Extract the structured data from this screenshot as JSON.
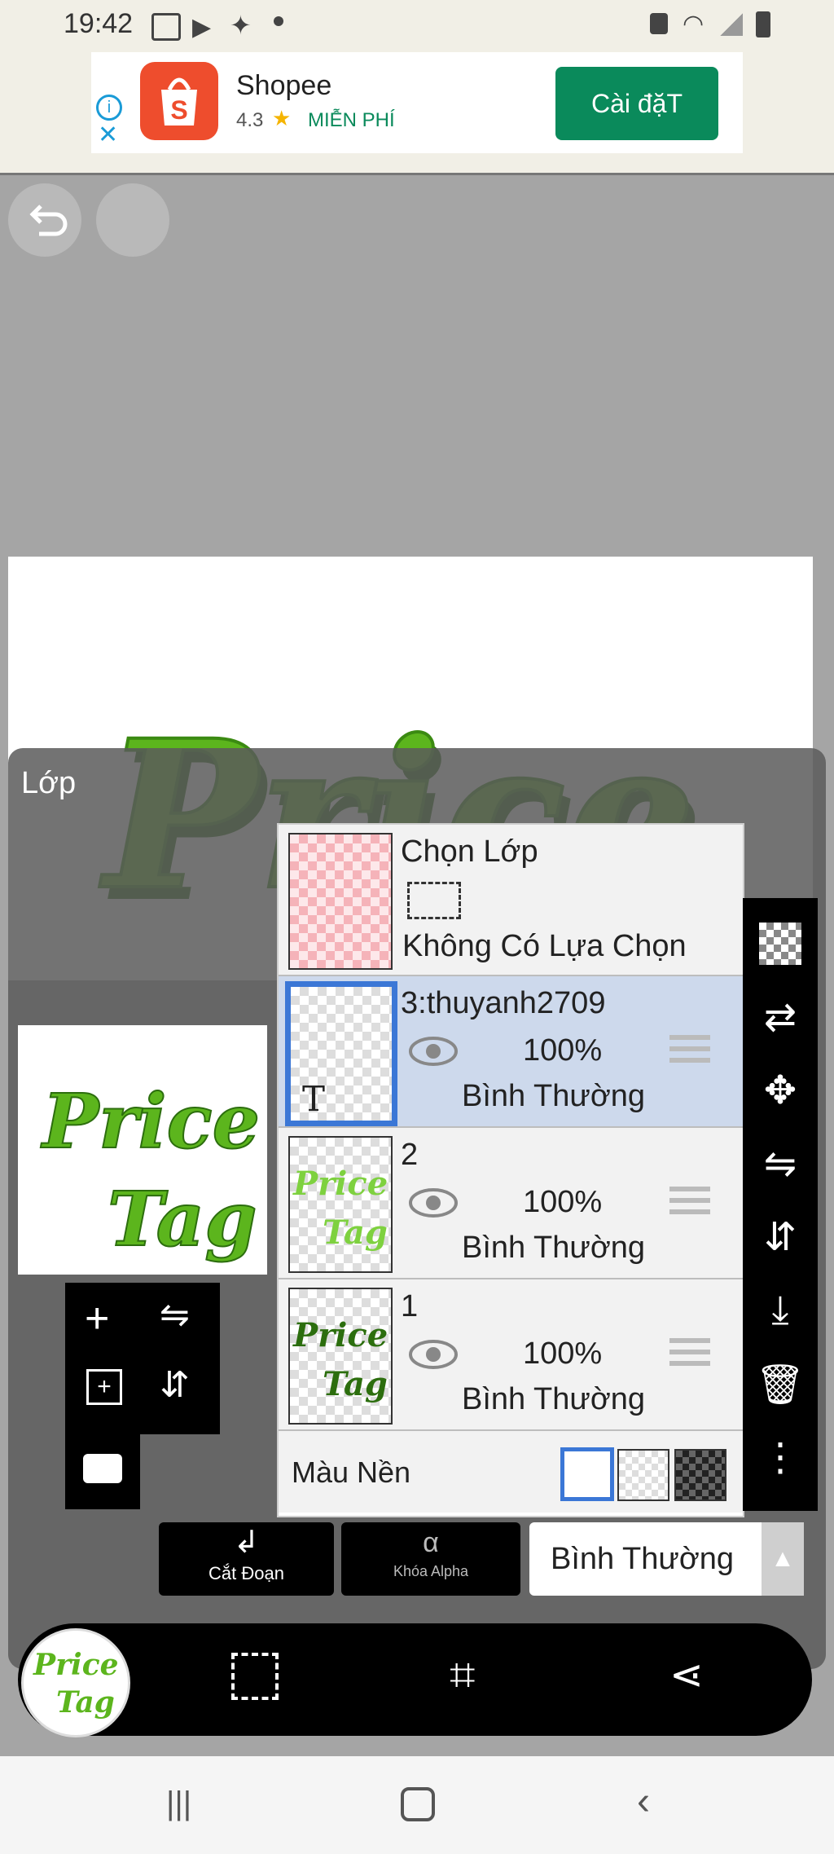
{
  "status_bar": {
    "time": "19:42"
  },
  "ad": {
    "app_name": "Shopee",
    "rating": "4.3",
    "price": "MIỄN PHÍ",
    "install_label": "Cài đặT"
  },
  "canvas": {
    "artwork_text_1": "Price",
    "artwork_text_2": "Tag"
  },
  "panel": {
    "title": "Lớp",
    "select_layer": {
      "title": "Chọn Lớp",
      "subtitle": "Không Có Lựa Chọn"
    },
    "layers": [
      {
        "name": "3:thuyanh2709",
        "opacity": "100%",
        "mode": "Bình Thường",
        "thumb_text": "T"
      },
      {
        "name": "2",
        "opacity": "100%",
        "mode": "Bình Thường"
      },
      {
        "name": "1",
        "opacity": "100%",
        "mode": "Bình Thường"
      }
    ],
    "background_label": "Màu Nền",
    "clip_label": "Cắt Đoạn",
    "alpha_lock_label": "Khóa Alpha",
    "blend_mode": "Bình Thường"
  }
}
